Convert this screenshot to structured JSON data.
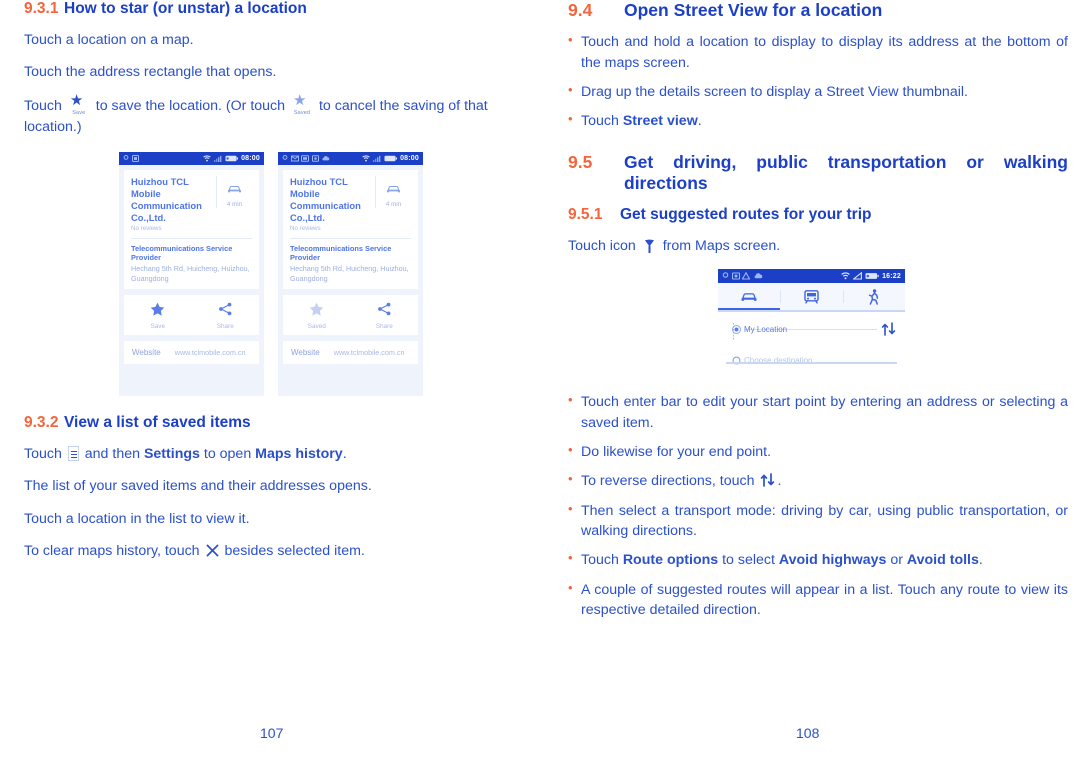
{
  "colors": {
    "heading_number": "#F4653C",
    "heading_text": "#1B3FC6",
    "body_text": "#2B50CC",
    "bullet": "#F4653C",
    "phone_statusbar": "#1B3FC6",
    "phone_bg": "#EFF3FC"
  },
  "left_column": {
    "section_931": {
      "number": "9.3.1",
      "title": "How to star (or unstar) a location",
      "paragraphs": [
        "Touch a location on a map.",
        "Touch the address rectangle that opens."
      ],
      "star_sentence": {
        "before": "Touch",
        "save_label": "Save",
        "middle": "to save the location. (Or touch",
        "saved_label": "Saved",
        "after": "to cancel the saving of that location.)"
      }
    },
    "section_932": {
      "number": "9.3.2",
      "title": "View a list of saved items",
      "line1": {
        "before": "Touch",
        "menu_icon": "menu-icon",
        "mid1": "and then",
        "bold1": "Settings",
        "mid2": "to open",
        "bold2": "Maps history",
        "end": "."
      },
      "paragraphs": [
        "The list of your saved items and their addresses opens.",
        "Touch a location in the list to view it."
      ],
      "line_clear": {
        "before": "To clear maps history, touch",
        "icon": "close-x-icon",
        "after": "besides selected item."
      }
    },
    "page_number": "107"
  },
  "phone_shots": [
    {
      "id": "save-state",
      "status_time": "08:00",
      "status_icons": [
        "location-icon",
        "screenshot-icon"
      ],
      "status_right_icons": [
        "wifi-icon",
        "signal-icon",
        "battery-icon"
      ],
      "business_name": "Huizhou TCL Mobile Communication Co.,Ltd.",
      "reviews": "No reviews",
      "travel_icon": "car-icon",
      "travel_time": "4 min",
      "category": "Telecommunications Service Provider",
      "address": "Hechang 5th Rd, Huicheng, Huizhou, Guangdong",
      "actions": [
        {
          "icon": "star-filled-icon",
          "label": "Save",
          "state": "filled"
        },
        {
          "icon": "share-icon",
          "label": "Share",
          "state": "normal"
        }
      ],
      "website_label": "Website",
      "website_url": "www.tclmobile.com.cn"
    },
    {
      "id": "saved-state",
      "status_time": "08:00",
      "status_icons": [
        "location-icon",
        "mail-icon",
        "screenshot-icon",
        "photo-icon",
        "cloud-icon"
      ],
      "status_right_icons": [
        "wifi-icon",
        "signal-icon",
        "battery-icon"
      ],
      "business_name": "Huizhou TCL Mobile Communication Co.,Ltd.",
      "reviews": "No reviews",
      "travel_icon": "car-icon",
      "travel_time": "4 min",
      "category": "Telecommunications Service Provider",
      "address": "Hechang 5th Rd, Huicheng, Huizhou, Guangdong",
      "actions": [
        {
          "icon": "star-outline-icon",
          "label": "Saved",
          "state": "light"
        },
        {
          "icon": "share-icon",
          "label": "Share",
          "state": "normal"
        }
      ],
      "website_label": "Website",
      "website_url": "www.tclmobile.com.cn"
    }
  ],
  "right_column": {
    "section_94": {
      "number": "9.4",
      "title": "Open Street View for a location",
      "bullets": [
        {
          "text": "Touch and hold a location to display to display its address at the bottom of the maps screen."
        },
        {
          "text": "Drag up the details screen to display a Street View thumbnail."
        },
        {
          "before": "Touch ",
          "bold": "Street view",
          "after": "."
        }
      ]
    },
    "section_95": {
      "number": "9.5",
      "title": "Get driving, public transportation or walking directions"
    },
    "section_951": {
      "number": "9.5.1",
      "title": "Get suggested routes for your trip",
      "intro": {
        "before": "Touch icon",
        "icon": "directions-icon",
        "after": "from Maps screen."
      },
      "bullets": [
        {
          "text": "Touch enter bar to edit your start point by entering an address or selecting a saved item."
        },
        {
          "text": "Do likewise for your end point."
        },
        {
          "before": "To reverse directions, touch ",
          "icon": "swap-arrows-icon",
          "after": "."
        },
        {
          "text": "Then select a transport mode: driving by car, using public transportation, or walking directions."
        },
        {
          "before": "Touch ",
          "bold1": "Route options",
          "mid1": " to select ",
          "bold2": "Avoid highways",
          "mid2": " or ",
          "bold3": "Avoid tolls",
          "after": "."
        },
        {
          "text": "A couple of suggested routes will appear in a list. Touch any route to view its respective detailed direction."
        }
      ]
    },
    "page_number": "108"
  },
  "directions_shot": {
    "status_time": "16:22",
    "status_icons": [
      "location-icon",
      "photo-icon",
      "warning-icon",
      "cloud-icon"
    ],
    "status_right_icons": [
      "wifi-icon",
      "mute-icon",
      "battery-icon"
    ],
    "modes": [
      {
        "icon": "car-icon",
        "label": "driving",
        "active": true
      },
      {
        "icon": "transit-icon",
        "label": "transit",
        "active": false
      },
      {
        "icon": "walk-icon",
        "label": "walking",
        "active": false
      }
    ],
    "start_point": "My Location",
    "end_point": "Choose destination...",
    "swap_icon": "swap-arrows-icon"
  }
}
